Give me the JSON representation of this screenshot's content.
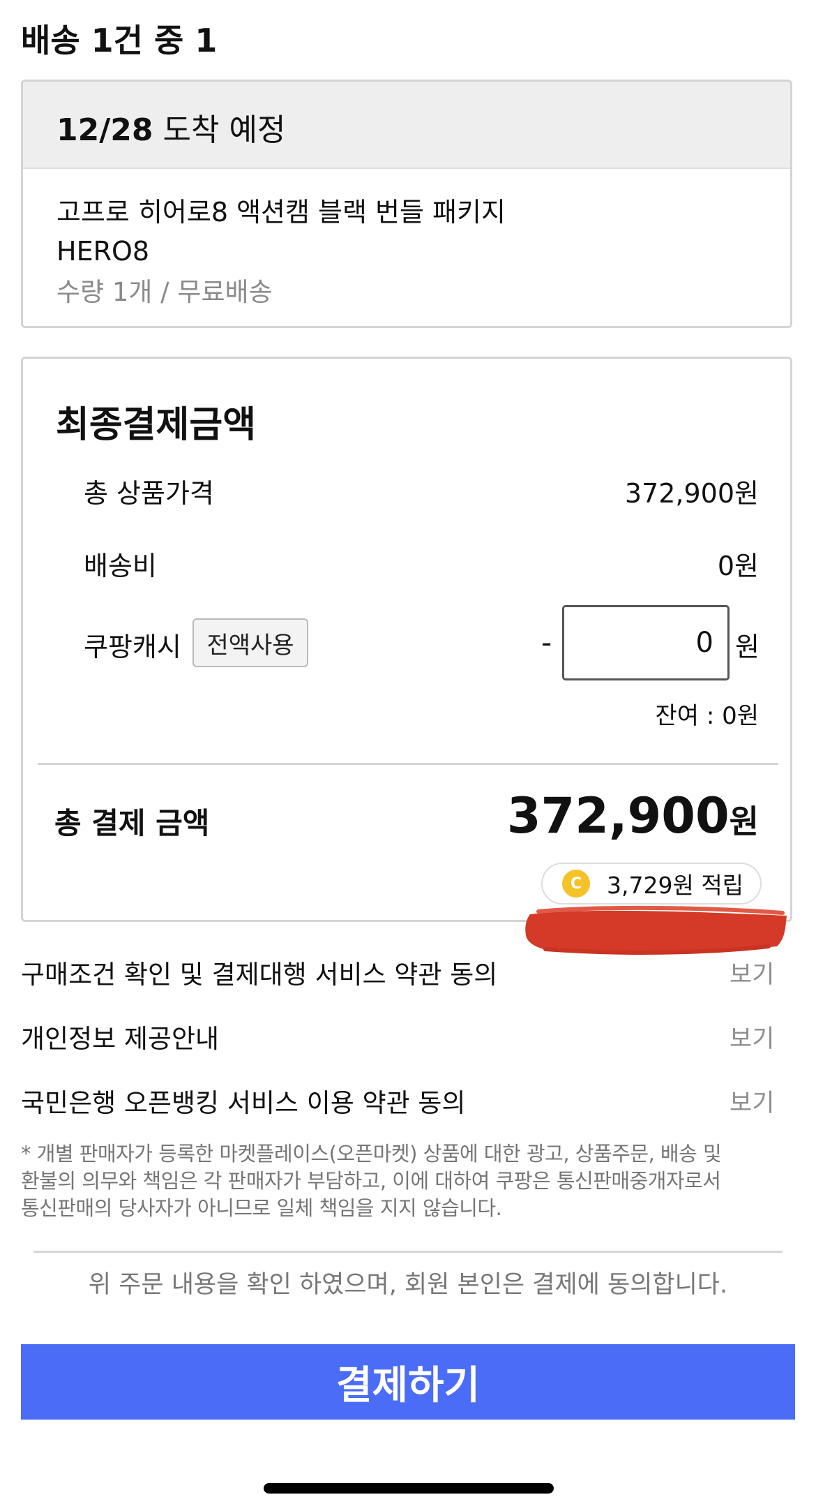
{
  "delivery": {
    "heading": "배송 1건 중 1",
    "date": "12/28",
    "date_suffix": " 도착 예정",
    "product_name_line1": "고프로 히어로8 액션캠 블랙 번들 패키지",
    "product_name_line2": "HERO8",
    "product_meta": "수량 1개 / 무료배송"
  },
  "payment": {
    "title": "최종결제금액",
    "rows": [
      {
        "label": "총 상품가격",
        "value": "372,900원"
      },
      {
        "label": "배송비",
        "value": "0원"
      }
    ],
    "cash": {
      "label": "쿠팡캐시",
      "full_use_button": "전액사용",
      "minus": "-",
      "input_value": "0",
      "unit": "원",
      "balance": "잔여 : 0원"
    },
    "total_label": "총 결제 금액",
    "total_amount": "372,900",
    "total_unit": "원",
    "reward_coin_letter": "C",
    "reward_text": "3,729원 적립"
  },
  "terms": [
    {
      "label": "구매조건 확인 및 결제대행 서비스 약관 동의",
      "action": "보기"
    },
    {
      "label": "개인정보 제공안내",
      "action": "보기"
    },
    {
      "label": "국민은행 오픈뱅킹 서비스 이용 약관 동의",
      "action": "보기"
    }
  ],
  "notice_lines": [
    "* 개별 판매자가 등록한 마켓플레이스(오픈마켓) 상품에 대한 광고, 상품주문, 배송 및",
    "환불의 의무와 책임은 각 판매자가 부담하고, 이에 대하여 쿠팡은 통신판매중개자로서",
    "통신판매의 당사자가 아니므로 일체 책임을 지지 않습니다."
  ],
  "consent": "위 주문 내용을 확인 하였으며, 회원 본인은 결제에 동의합니다.",
  "pay_button": "결제하기",
  "colors": {
    "pay_button": "#4a6cf7",
    "coin": "#f5c328",
    "redaction": "#d43a27"
  }
}
